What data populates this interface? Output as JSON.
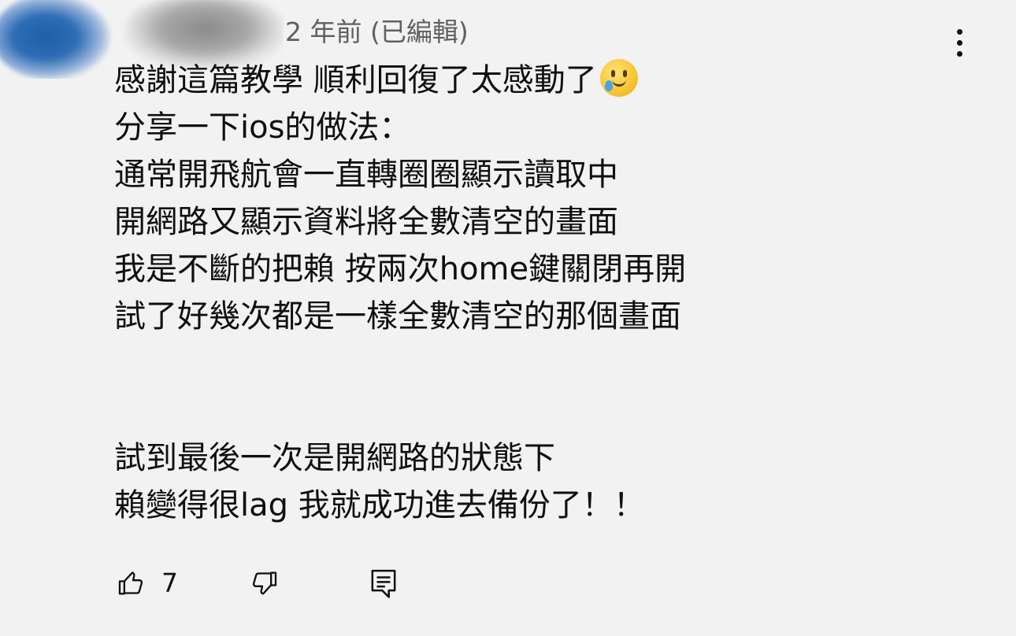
{
  "comment": {
    "timestamp": "2 年前 (已編輯)",
    "lines": [
      "感謝這篇教學 順利回復了太感動了",
      "分享一下ios的做法：",
      "通常開飛航會一直轉圈圈顯示讀取中",
      "開網路又顯示資料將全數清空的畫面",
      "我是不斷的把賴 按兩次home鍵關閉再開",
      "試了好幾次都是一樣全數清空的那個畫面",
      "",
      "試到最後一次是開網路的狀態下",
      "賴變得很lag 我就成功進去備份了！！"
    ],
    "emoji": "face-holding-back-tears-emoji"
  },
  "actions": {
    "like_count": "7",
    "like_icon": "thumbs-up-icon",
    "dislike_icon": "thumbs-down-icon",
    "reply_icon": "reply-comment-icon",
    "more_icon": "more-vertical-icon"
  }
}
